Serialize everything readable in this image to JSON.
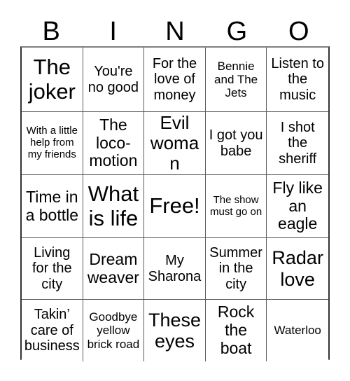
{
  "card": {
    "title": "BINGO",
    "header_letters": [
      "B",
      "I",
      "N",
      "G",
      "O"
    ],
    "free_space_label": "Free!",
    "colors": {
      "text": "#000000",
      "grid_line": "#5a5a5a",
      "border": "#333333",
      "background": "#ffffff"
    },
    "rows": [
      [
        {
          "text": "The joker",
          "size": "fs-1"
        },
        {
          "text": "You're no good",
          "size": "fs-4"
        },
        {
          "text": "For the love of money",
          "size": "fs-4"
        },
        {
          "text": "Bennie and The Jets",
          "size": "fs-5"
        },
        {
          "text": "Listen to the music",
          "size": "fs-4"
        }
      ],
      [
        {
          "text": "With a little help from my friends",
          "size": "fs-6"
        },
        {
          "text": "The loco- motion",
          "size": "fs-3"
        },
        {
          "text": "Evil woman",
          "size": "fs-2"
        },
        {
          "text": "I got you babe",
          "size": "fs-4"
        },
        {
          "text": "I shot the sheriff",
          "size": "fs-4"
        }
      ],
      [
        {
          "text": "Time in a bottle",
          "size": "fs-3"
        },
        {
          "text": "What is life",
          "size": "fs-1"
        },
        {
          "text": "Free!",
          "size": "fs-1"
        },
        {
          "text": "The show must go on",
          "size": "fs-6"
        },
        {
          "text": "Fly like an eagle",
          "size": "fs-3"
        }
      ],
      [
        {
          "text": "Living for the city",
          "size": "fs-4"
        },
        {
          "text": "Dream weaver",
          "size": "fs-3"
        },
        {
          "text": "My Sharona",
          "size": "fs-4"
        },
        {
          "text": "Summer in the city",
          "size": "fs-4"
        },
        {
          "text": "Radar love",
          "size": "fs-2"
        }
      ],
      [
        {
          "text": "Takin’ care of business",
          "size": "fs-4"
        },
        {
          "text": "Goodbye yellow brick road",
          "size": "fs-5"
        },
        {
          "text": "These eyes",
          "size": "fs-2"
        },
        {
          "text": "Rock the boat",
          "size": "fs-3"
        },
        {
          "text": "Waterloo",
          "size": "fs-5"
        }
      ]
    ]
  }
}
